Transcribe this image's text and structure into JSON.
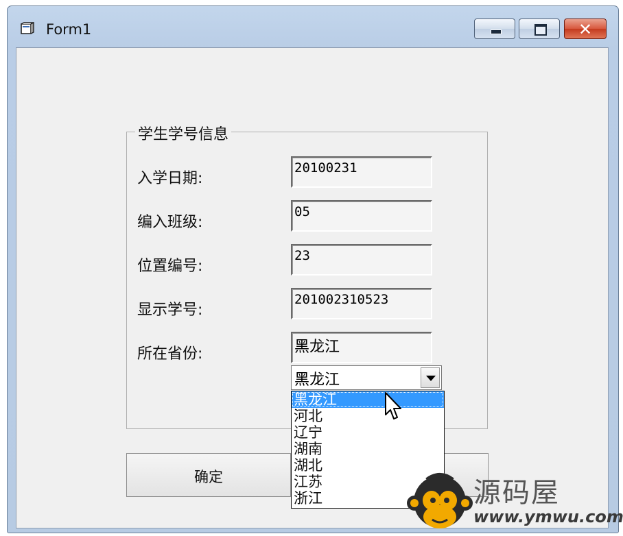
{
  "window": {
    "title": "Form1",
    "icon": "form-icon",
    "buttons": {
      "minimize": "minimize-icon",
      "maximize": "maximize-icon",
      "close": "✕"
    }
  },
  "group": {
    "title": "学生学号信息",
    "fields": [
      {
        "label": "入学日期:",
        "value": "20100231"
      },
      {
        "label": "编入班级:",
        "value": "05"
      },
      {
        "label": "位置编号:",
        "value": "23"
      },
      {
        "label": "显示学号:",
        "value": "201002310523"
      },
      {
        "label": "所在省份:",
        "value": "黑龙江"
      }
    ]
  },
  "combo": {
    "selected": "黑龙江",
    "options": [
      "黑龙江",
      "河北",
      "辽宁",
      "湖南",
      "湖北",
      "江苏",
      "浙江"
    ]
  },
  "buttons": {
    "ok": "确定"
  },
  "watermark": {
    "name": "源码屋",
    "url": "www.ymwu.com"
  },
  "colors": {
    "selection": "#3399ff",
    "titlebar": "#b9cde6",
    "close": "#c43a1e"
  }
}
